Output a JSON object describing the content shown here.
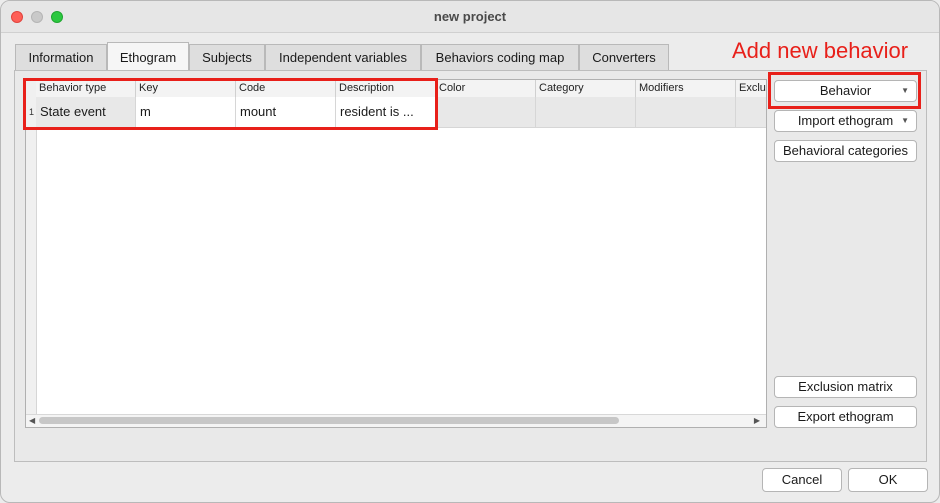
{
  "window": {
    "title": "new project"
  },
  "tabs": [
    {
      "label": "Information"
    },
    {
      "label": "Ethogram"
    },
    {
      "label": "Subjects"
    },
    {
      "label": "Independent variables"
    },
    {
      "label": "Behaviors coding map"
    },
    {
      "label": "Converters"
    }
  ],
  "active_tab": "Ethogram",
  "table": {
    "columns": [
      "Behavior type",
      "Key",
      "Code",
      "Description",
      "Color",
      "Category",
      "Modifiers",
      "Exclu"
    ],
    "rows": [
      {
        "num": "1",
        "cells": [
          "State event",
          "m",
          "mount",
          "resident is ...",
          "",
          "",
          "",
          ""
        ]
      }
    ]
  },
  "side_buttons": {
    "behavior": "Behavior",
    "import_ethogram": "Import ethogram",
    "behavioral_categories": "Behavioral categories",
    "exclusion_matrix": "Exclusion matrix",
    "export_ethogram": "Export ethogram"
  },
  "dialog_buttons": {
    "cancel": "Cancel",
    "ok": "OK"
  },
  "annotation": {
    "text": "Add new behavior"
  },
  "colors": {
    "annotation_red": "#e8201a",
    "close": "#fe5f57",
    "maximize": "#2cc840"
  }
}
